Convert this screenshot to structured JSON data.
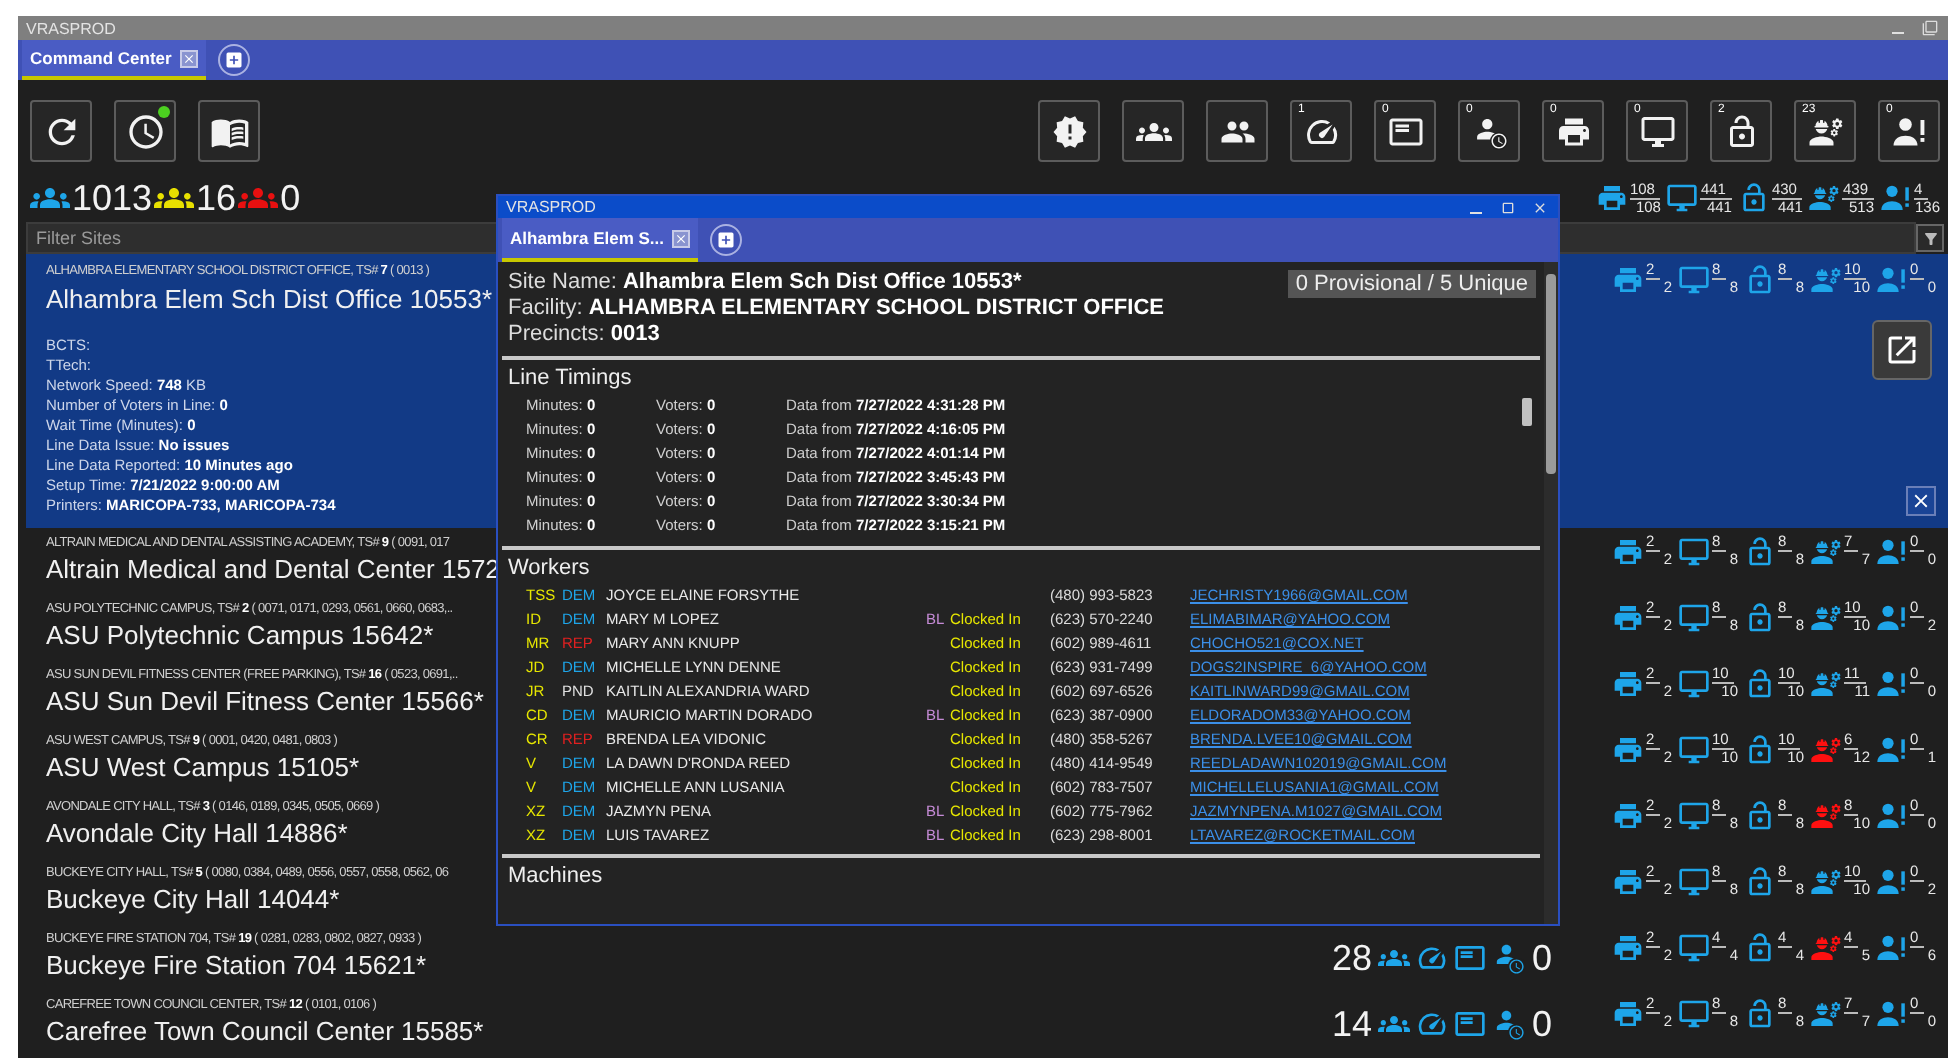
{
  "window": {
    "title": "VRASPROD"
  },
  "tabs": [
    {
      "label": "Command Center",
      "selected": true
    }
  ],
  "toolbar": {
    "left": [
      {
        "kind": "refresh",
        "notification": false
      },
      {
        "kind": "history",
        "notification": true
      },
      {
        "kind": "guide",
        "notification": false
      }
    ],
    "right": [
      {
        "kind": "alert"
      },
      {
        "kind": "groups"
      },
      {
        "kind": "people"
      },
      {
        "kind": "gauge",
        "count": "1"
      },
      {
        "kind": "card",
        "count": "0"
      },
      {
        "kind": "person-clock",
        "count": "0"
      },
      {
        "kind": "printer",
        "count": "0"
      },
      {
        "kind": "monitor",
        "count": "0"
      },
      {
        "kind": "lock",
        "count": "2"
      },
      {
        "kind": "worker",
        "count": "23"
      },
      {
        "kind": "person-alert",
        "count": "0"
      }
    ]
  },
  "summary": {
    "people": [
      {
        "count": "1013",
        "color": "#1ea5e9"
      },
      {
        "count": "16",
        "color": "#e8e000"
      },
      {
        "count": "0",
        "color": "#e81010"
      }
    ],
    "equipment": [
      {
        "kind": "printer",
        "num": "108",
        "den": "108"
      },
      {
        "kind": "monitor",
        "num": "441",
        "den": "441"
      },
      {
        "kind": "lock",
        "num": "430",
        "den": "441"
      },
      {
        "kind": "worker",
        "num": "439",
        "den": "513"
      },
      {
        "kind": "person-alert",
        "num": "4",
        "den": "136"
      }
    ]
  },
  "filter": {
    "placeholder": "Filter Sites"
  },
  "sites": [
    {
      "subtitle": "ALHAMBRA ELEMENTARY SCHOOL DISTRICT OFFICE, TS# **7** ( 0013 )",
      "name": "Alhambra Elem Sch Dist Office 10553*",
      "selected": true,
      "details": [
        "BCTS:",
        "TTech:",
        "Network Speed: **748** KB",
        "Number of Voters in Line: **0**",
        "Wait Time (Minutes): **0**",
        "Line Data Issue: **No issues**",
        "Line Data Reported: **10 Minutes ago**",
        "Setup Time: **7/21/2022 9:00:00 AM**",
        "Printers: **MARICOPA-733, MARICOPA-734**"
      ],
      "stats": [
        {
          "kind": "printer",
          "num": "2",
          "den": "2",
          "alert": false
        },
        {
          "kind": "monitor",
          "num": "8",
          "den": "8",
          "alert": false
        },
        {
          "kind": "lock",
          "num": "8",
          "den": "8",
          "alert": false
        },
        {
          "kind": "worker",
          "num": "10",
          "den": "10",
          "alert": false
        },
        {
          "kind": "person-alert",
          "num": "0",
          "den": "0",
          "alert": false
        }
      ]
    },
    {
      "subtitle": "ALTRAIN MEDICAL AND DENTAL ASSISTING ACADEMY, TS# **9** ( 0091, 017",
      "name": "Altrain Medical and Dental Center 1572",
      "selected": false,
      "stats": [
        {
          "kind": "printer",
          "num": "2",
          "den": "2",
          "alert": false
        },
        {
          "kind": "monitor",
          "num": "8",
          "den": "8",
          "alert": false
        },
        {
          "kind": "lock",
          "num": "8",
          "den": "8",
          "alert": false
        },
        {
          "kind": "worker",
          "num": "7",
          "den": "7",
          "alert": false
        },
        {
          "kind": "person-alert",
          "num": "0",
          "den": "0",
          "alert": false
        }
      ]
    },
    {
      "subtitle": "ASU POLYTECHNIC CAMPUS, TS# **2** ( 0071, 0171, 0293, 0561, 0660, 0683,..",
      "name": "ASU Polytechnic Campus 15642*",
      "selected": false,
      "stats": [
        {
          "kind": "printer",
          "num": "2",
          "den": "2",
          "alert": false
        },
        {
          "kind": "monitor",
          "num": "8",
          "den": "8",
          "alert": false
        },
        {
          "kind": "lock",
          "num": "8",
          "den": "8",
          "alert": false
        },
        {
          "kind": "worker",
          "num": "10",
          "den": "10",
          "alert": false
        },
        {
          "kind": "person-alert",
          "num": "0",
          "den": "2",
          "alert": false
        }
      ]
    },
    {
      "subtitle": "ASU SUN DEVIL FITNESS CENTER (FREE PARKING), TS# **16** ( 0523, 0691,..",
      "name": "ASU Sun Devil Fitness Center 15566*",
      "selected": false,
      "stats": [
        {
          "kind": "printer",
          "num": "2",
          "den": "2",
          "alert": false
        },
        {
          "kind": "monitor",
          "num": "10",
          "den": "10",
          "alert": false
        },
        {
          "kind": "lock",
          "num": "10",
          "den": "10",
          "alert": false
        },
        {
          "kind": "worker",
          "num": "11",
          "den": "11",
          "alert": false
        },
        {
          "kind": "person-alert",
          "num": "0",
          "den": "0",
          "alert": false
        }
      ]
    },
    {
      "subtitle": "ASU WEST CAMPUS, TS# **9** ( 0001, 0420, 0481, 0803 )",
      "name": "ASU West Campus 15105*",
      "selected": false,
      "stats": [
        {
          "kind": "printer",
          "num": "2",
          "den": "2",
          "alert": false
        },
        {
          "kind": "monitor",
          "num": "10",
          "den": "10",
          "alert": false
        },
        {
          "kind": "lock",
          "num": "10",
          "den": "10",
          "alert": false
        },
        {
          "kind": "worker",
          "num": "6",
          "den": "12",
          "alert": true
        },
        {
          "kind": "person-alert",
          "num": "0",
          "den": "1",
          "alert": false
        }
      ]
    },
    {
      "subtitle": "AVONDALE CITY HALL, TS# **3** ( 0146, 0189, 0345, 0505, 0669 )",
      "name": "Avondale City Hall 14886*",
      "selected": false,
      "stats": [
        {
          "kind": "printer",
          "num": "2",
          "den": "2",
          "alert": false
        },
        {
          "kind": "monitor",
          "num": "8",
          "den": "8",
          "alert": false
        },
        {
          "kind": "lock",
          "num": "8",
          "den": "8",
          "alert": false
        },
        {
          "kind": "worker",
          "num": "8",
          "den": "10",
          "alert": true
        },
        {
          "kind": "person-alert",
          "num": "0",
          "den": "0",
          "alert": false
        }
      ]
    },
    {
      "subtitle": "BUCKEYE CITY HALL, TS# **5** ( 0080, 0384, 0489, 0556, 0557, 0558, 0562, 06",
      "name": "Buckeye City Hall 14044*",
      "selected": false,
      "stats": [
        {
          "kind": "printer",
          "num": "2",
          "den": "2",
          "alert": false
        },
        {
          "kind": "monitor",
          "num": "8",
          "den": "8",
          "alert": false
        },
        {
          "kind": "lock",
          "num": "8",
          "den": "8",
          "alert": false
        },
        {
          "kind": "worker",
          "num": "10",
          "den": "10",
          "alert": false
        },
        {
          "kind": "person-alert",
          "num": "0",
          "den": "2",
          "alert": false
        }
      ]
    },
    {
      "subtitle": "BUCKEYE FIRE STATION 704, TS# **19** ( 0281, 0283, 0802, 0827, 0933 )",
      "name": "Buckeye Fire Station 704 15621*",
      "selected": false,
      "counts": {
        "voters": "28",
        "waiting": "0"
      },
      "stats": [
        {
          "kind": "printer",
          "num": "2",
          "den": "2",
          "alert": false
        },
        {
          "kind": "monitor",
          "num": "4",
          "den": "4",
          "alert": false
        },
        {
          "kind": "lock",
          "num": "4",
          "den": "4",
          "alert": false
        },
        {
          "kind": "worker",
          "num": "4",
          "den": "5",
          "alert": true
        },
        {
          "kind": "person-alert",
          "num": "0",
          "den": "6",
          "alert": false
        }
      ]
    },
    {
      "subtitle": "CAREFREE TOWN COUNCIL CENTER, TS# **12** ( 0101, 0106 )",
      "name": "Carefree Town Council Center 15585*",
      "selected": false,
      "counts": {
        "voters": "14",
        "waiting": "0"
      },
      "stats": [
        {
          "kind": "printer",
          "num": "2",
          "den": "2",
          "alert": false
        },
        {
          "kind": "monitor",
          "num": "8",
          "den": "8",
          "alert": false
        },
        {
          "kind": "lock",
          "num": "8",
          "den": "8",
          "alert": false
        },
        {
          "kind": "worker",
          "num": "7",
          "den": "7",
          "alert": false
        },
        {
          "kind": "person-alert",
          "num": "0",
          "den": "0",
          "alert": false
        }
      ]
    }
  ],
  "popup": {
    "title": "VRASPROD",
    "tabs": [
      {
        "label": "Alhambra Elem S...",
        "selected": true
      }
    ],
    "info": [
      {
        "label": "Site Name:",
        "value": "Alhambra Elem Sch Dist Office 10553*"
      },
      {
        "label": "Facility:",
        "value": "ALHAMBRA ELEMENTARY SCHOOL DISTRICT OFFICE"
      },
      {
        "label": "Precincts:",
        "value": "0013"
      }
    ],
    "badge": "0 Provisional / 5 Unique",
    "line_timings": {
      "heading": "Line Timings",
      "rows": [
        {
          "minutes": "Minutes: **0**",
          "voters": "Voters: **0**",
          "data": "Data from **7/27/2022 4:31:28 PM**"
        },
        {
          "minutes": "Minutes: **0**",
          "voters": "Voters: **0**",
          "data": "Data from **7/27/2022 4:16:05 PM**"
        },
        {
          "minutes": "Minutes: **0**",
          "voters": "Voters: **0**",
          "data": "Data from **7/27/2022 4:01:14 PM**"
        },
        {
          "minutes": "Minutes: **0**",
          "voters": "Voters: **0**",
          "data": "Data from **7/27/2022 3:45:43 PM**"
        },
        {
          "minutes": "Minutes: **0**",
          "voters": "Voters: **0**",
          "data": "Data from **7/27/2022 3:30:34 PM**"
        },
        {
          "minutes": "Minutes: **0**",
          "voters": "Voters: **0**",
          "data": "Data from **7/27/2022 3:15:21 PM**"
        }
      ]
    },
    "workers": {
      "heading": "Workers",
      "rows": [
        {
          "role": "TSS",
          "party": "DEM",
          "color": "#1ea5e9",
          "name": "JOYCE ELAINE FORSYTHE",
          "phone": "(480) 993-5823",
          "email": "JECHRISTY1966@GMAIL.COM"
        },
        {
          "role": "ID",
          "party": "DEM",
          "color": "#1ea5e9",
          "name": "MARY M LOPEZ",
          "bl": "BL",
          "status": "Clocked In",
          "phone": "(623) 570-2240",
          "email": "ELIMABIMAR@YAHOO.COM"
        },
        {
          "role": "MR",
          "party": "REP",
          "color": "#e02020",
          "name": "MARY ANN KNUPP",
          "status": "Clocked In",
          "phone": "(602) 989-4611",
          "email": "CHOCHO521@COX.NET"
        },
        {
          "role": "JD",
          "party": "DEM",
          "color": "#1ea5e9",
          "name": "MICHELLE LYNN DENNE",
          "status": "Clocked In",
          "phone": "(623) 931-7499",
          "email": "DOGS2INSPIRE_6@YAHOO.COM"
        },
        {
          "role": "JR",
          "party": "PND",
          "color": "#e0e0e0",
          "name": "KAITLIN ALEXANDRIA WARD",
          "status": "Clocked In",
          "phone": "(602) 697-6526",
          "email": "KAITLINWARD99@GMAIL.COM"
        },
        {
          "role": "CD",
          "party": "DEM",
          "color": "#1ea5e9",
          "name": "MAURICIO MARTIN DORADO",
          "bl": "BL",
          "status": "Clocked In",
          "phone": "(623) 387-0900",
          "email": "ELDORADOM33@YAHOO.COM"
        },
        {
          "role": "CR",
          "party": "REP",
          "color": "#e02020",
          "name": "BRENDA LEA VIDONIC",
          "status": "Clocked In",
          "phone": "(480) 358-5267",
          "email": "BRENDA.LVEE10@GMAIL.COM"
        },
        {
          "role": "V",
          "party": "DEM",
          "color": "#1ea5e9",
          "name": "LA DAWN D'RONDA REED",
          "status": "Clocked In",
          "phone": "(480) 414-9549",
          "email": "REEDLADAWN102019@GMAIL.COM"
        },
        {
          "role": "V",
          "party": "DEM",
          "color": "#1ea5e9",
          "name": "MICHELLE ANN LUSANIA",
          "status": "Clocked In",
          "phone": "(602) 783-7507",
          "email": "MICHELLELUSANIA1@GMAIL.COM"
        },
        {
          "role": "XZ",
          "party": "DEM",
          "color": "#1ea5e9",
          "name": "JAZMYN PENA",
          "bl": "BL",
          "status": "Clocked In",
          "phone": "(602) 775-7962",
          "email": "JAZMYNPENA.M1027@GMAIL.COM"
        },
        {
          "role": "XZ",
          "party": "DEM",
          "color": "#1ea5e9",
          "name": "LUIS TAVAREZ",
          "bl": "BL",
          "status": "Clocked In",
          "phone": "(623) 298-8001",
          "email": "LTAVAREZ@ROCKETMAIL.COM"
        }
      ]
    },
    "machines": {
      "heading": "Machines"
    }
  }
}
